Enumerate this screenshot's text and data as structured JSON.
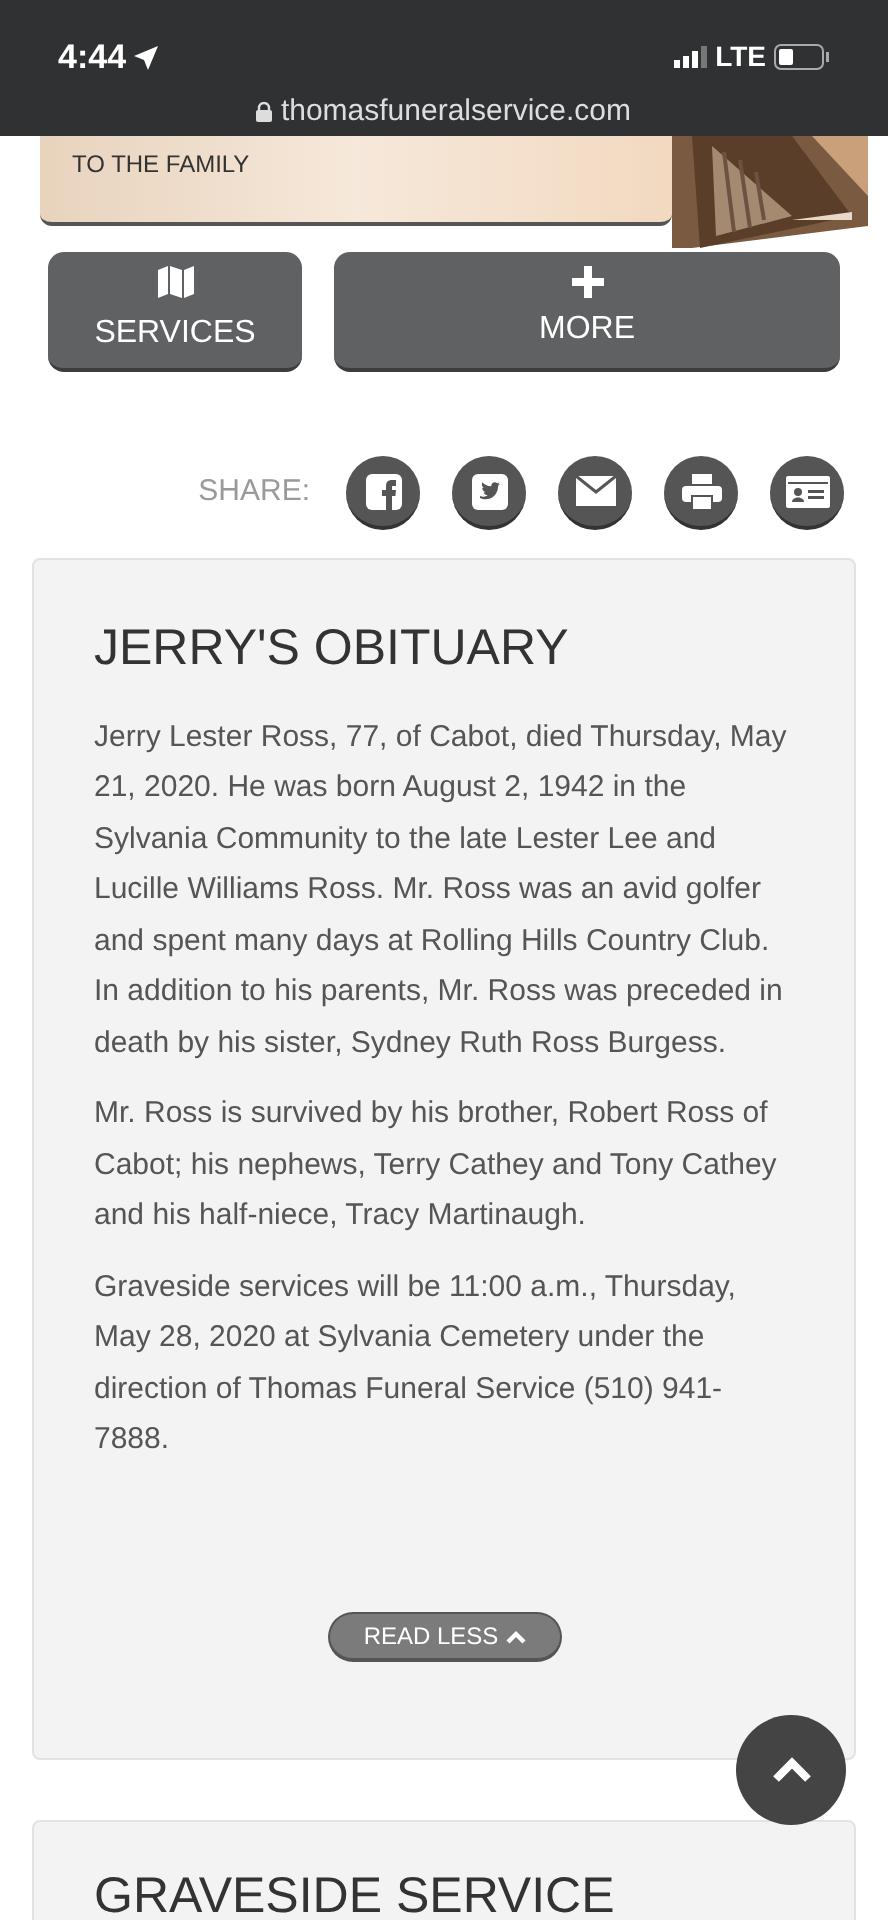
{
  "status_bar": {
    "time": "4:44",
    "network": "LTE"
  },
  "address_bar": {
    "url": "thomasfuneralservice.com"
  },
  "banner": {
    "text": "TO THE FAMILY"
  },
  "nav_buttons": [
    {
      "label": "SERVICES",
      "kind": "map"
    },
    {
      "label": "MORE",
      "kind": "plus"
    }
  ],
  "share": {
    "label": "SHARE:",
    "buttons": [
      {
        "kind": "facebook"
      },
      {
        "kind": "twitter"
      },
      {
        "kind": "email"
      },
      {
        "kind": "print"
      },
      {
        "kind": "card"
      }
    ]
  },
  "obituary": {
    "title": "JERRY'S OBITUARY",
    "paragraphs": [
      "Jerry Lester Ross, 77, of Cabot, died Thursday, May 21, 2020. He was born August 2, 1942 in the Sylvania Community to the late Lester Lee and Lucille Williams Ross. Mr. Ross was an avid golfer and spent many days at Rolling Hills Country Club. In addition to his parents, Mr. Ross was preceded in death by his sister, Sydney Ruth Ross Burgess.",
      "Mr. Ross is survived by his brother, Robert Ross of Cabot; his nephews, Terry Cathey and Tony Cathey and his half-niece, Tracy Martinaugh.",
      "Graveside services will be 11:00 a.m., Thursday, May 28, 2020 at Sylvania Cemetery under the direction of Thomas Funeral Service (510) 941-7888."
    ],
    "read_less": "READ LESS"
  },
  "next_section": {
    "title": "GRAVESIDE SERVICE"
  }
}
